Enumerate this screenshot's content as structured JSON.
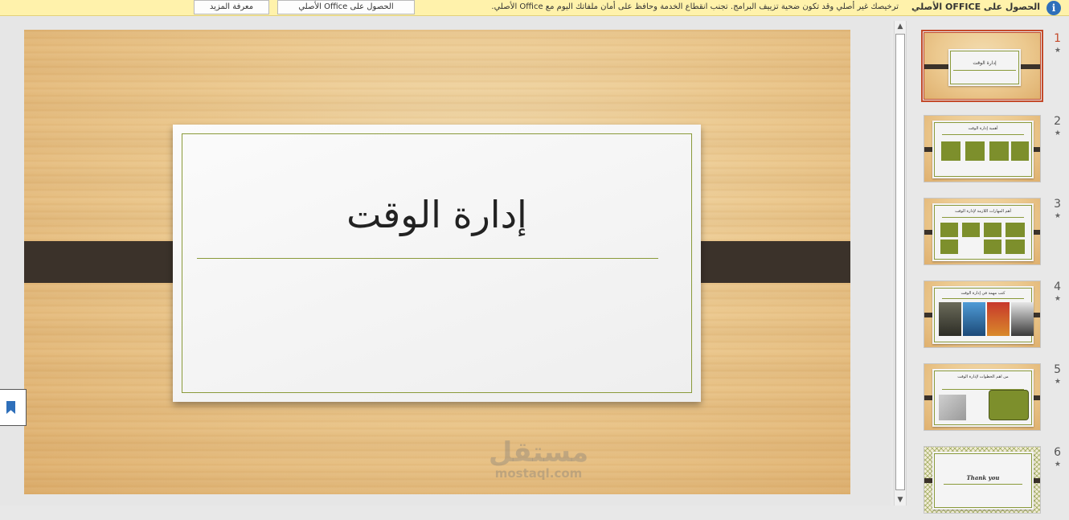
{
  "notice": {
    "title": "الحصول على OFFICE الأصلي",
    "message": "ترخيصك غير أصلي وقد تكون ضحية تزييف البرامج. تجنب انقطاع الخدمة وحافظ على أمان ملفاتك اليوم مع Office الأصلي.",
    "get_genuine_label": "الحصول على Office الأصلي",
    "learn_more_label": "معرفة المزيد",
    "info_icon": "i"
  },
  "slide": {
    "title": "إدارة الوقت"
  },
  "watermark": {
    "arabic": "مستقل",
    "latin": "mostaql.com"
  },
  "scrollbar": {
    "up": "▲",
    "down": "▼"
  },
  "thumbnails": [
    {
      "number": "1",
      "star": "★",
      "title": "إدارة الوقت",
      "selected": true
    },
    {
      "number": "2",
      "star": "★",
      "title": "أهمية إدارة الوقت"
    },
    {
      "number": "3",
      "star": "★",
      "title": "أهم المهارات اللازمة لإدارة الوقت"
    },
    {
      "number": "4",
      "star": "★",
      "title": "كتب مهمة في إدارة الوقت"
    },
    {
      "number": "5",
      "star": "★",
      "title": "من اهم الخطوات لإدارة الوقت"
    },
    {
      "number": "6",
      "star": "★",
      "title": "Thank you"
    }
  ],
  "colors": {
    "accent_selected": "#c44a2b",
    "olive": "#8a9a3a",
    "strap": "#3b322a",
    "notice_bg": "#fff2ab"
  }
}
